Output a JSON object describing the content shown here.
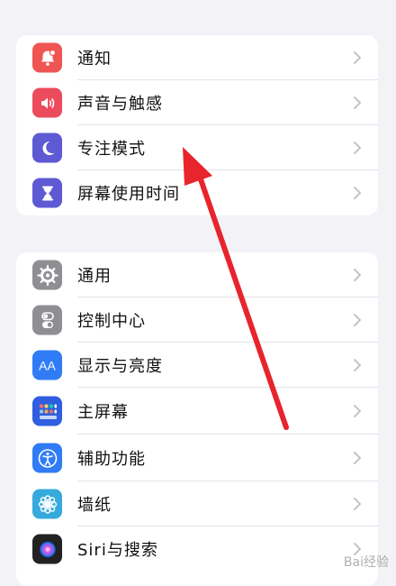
{
  "group1": {
    "items": [
      {
        "label": "通知",
        "icon": "bell-badge-icon",
        "color": "#ef5552"
      },
      {
        "label": "声音与触感",
        "icon": "speaker-icon",
        "color": "#ec4a5d"
      },
      {
        "label": "专注模式",
        "icon": "moon-icon",
        "color": "#5e5ad4"
      },
      {
        "label": "屏幕使用时间",
        "icon": "hourglass-icon",
        "color": "#5e5ad4"
      }
    ]
  },
  "group2": {
    "items": [
      {
        "label": "通用",
        "icon": "gear-icon",
        "color": "#8e8e93"
      },
      {
        "label": "控制中心",
        "icon": "toggles-icon",
        "color": "#8e8e93"
      },
      {
        "label": "显示与亮度",
        "icon": "text-size-icon",
        "color": "#2f7cf6"
      },
      {
        "label": "主屏幕",
        "icon": "home-grid-icon",
        "color": "#2f5fe0"
      },
      {
        "label": "辅助功能",
        "icon": "accessibility-icon",
        "color": "#2f7cf6"
      },
      {
        "label": "墙纸",
        "icon": "flower-icon",
        "color": "#36aadc"
      },
      {
        "label": "Siri与搜索",
        "icon": "siri-icon",
        "color": "#222222"
      }
    ]
  },
  "icon_text": {
    "display": "AA"
  },
  "watermark": {
    "text": "Bai经验"
  }
}
